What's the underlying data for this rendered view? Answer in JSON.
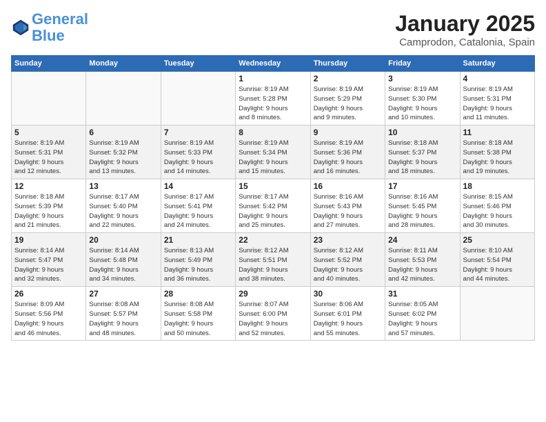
{
  "header": {
    "logo_line1": "General",
    "logo_line2": "Blue",
    "month": "January 2025",
    "location": "Camprodon, Catalonia, Spain"
  },
  "weekdays": [
    "Sunday",
    "Monday",
    "Tuesday",
    "Wednesday",
    "Thursday",
    "Friday",
    "Saturday"
  ],
  "rows": [
    {
      "shaded": false,
      "cells": [
        {
          "empty": true
        },
        {
          "empty": true
        },
        {
          "empty": true
        },
        {
          "day": "1",
          "info": "Sunrise: 8:19 AM\nSunset: 5:28 PM\nDaylight: 9 hours\nand 8 minutes."
        },
        {
          "day": "2",
          "info": "Sunrise: 8:19 AM\nSunset: 5:29 PM\nDaylight: 9 hours\nand 9 minutes."
        },
        {
          "day": "3",
          "info": "Sunrise: 8:19 AM\nSunset: 5:30 PM\nDaylight: 9 hours\nand 10 minutes."
        },
        {
          "day": "4",
          "info": "Sunrise: 8:19 AM\nSunset: 5:31 PM\nDaylight: 9 hours\nand 11 minutes."
        }
      ]
    },
    {
      "shaded": true,
      "cells": [
        {
          "day": "5",
          "info": "Sunrise: 8:19 AM\nSunset: 5:31 PM\nDaylight: 9 hours\nand 12 minutes."
        },
        {
          "day": "6",
          "info": "Sunrise: 8:19 AM\nSunset: 5:32 PM\nDaylight: 9 hours\nand 13 minutes."
        },
        {
          "day": "7",
          "info": "Sunrise: 8:19 AM\nSunset: 5:33 PM\nDaylight: 9 hours\nand 14 minutes."
        },
        {
          "day": "8",
          "info": "Sunrise: 8:19 AM\nSunset: 5:34 PM\nDaylight: 9 hours\nand 15 minutes."
        },
        {
          "day": "9",
          "info": "Sunrise: 8:19 AM\nSunset: 5:36 PM\nDaylight: 9 hours\nand 16 minutes."
        },
        {
          "day": "10",
          "info": "Sunrise: 8:18 AM\nSunset: 5:37 PM\nDaylight: 9 hours\nand 18 minutes."
        },
        {
          "day": "11",
          "info": "Sunrise: 8:18 AM\nSunset: 5:38 PM\nDaylight: 9 hours\nand 19 minutes."
        }
      ]
    },
    {
      "shaded": false,
      "cells": [
        {
          "day": "12",
          "info": "Sunrise: 8:18 AM\nSunset: 5:39 PM\nDaylight: 9 hours\nand 21 minutes."
        },
        {
          "day": "13",
          "info": "Sunrise: 8:17 AM\nSunset: 5:40 PM\nDaylight: 9 hours\nand 22 minutes."
        },
        {
          "day": "14",
          "info": "Sunrise: 8:17 AM\nSunset: 5:41 PM\nDaylight: 9 hours\nand 24 minutes."
        },
        {
          "day": "15",
          "info": "Sunrise: 8:17 AM\nSunset: 5:42 PM\nDaylight: 9 hours\nand 25 minutes."
        },
        {
          "day": "16",
          "info": "Sunrise: 8:16 AM\nSunset: 5:43 PM\nDaylight: 9 hours\nand 27 minutes."
        },
        {
          "day": "17",
          "info": "Sunrise: 8:16 AM\nSunset: 5:45 PM\nDaylight: 9 hours\nand 28 minutes."
        },
        {
          "day": "18",
          "info": "Sunrise: 8:15 AM\nSunset: 5:46 PM\nDaylight: 9 hours\nand 30 minutes."
        }
      ]
    },
    {
      "shaded": true,
      "cells": [
        {
          "day": "19",
          "info": "Sunrise: 8:14 AM\nSunset: 5:47 PM\nDaylight: 9 hours\nand 32 minutes."
        },
        {
          "day": "20",
          "info": "Sunrise: 8:14 AM\nSunset: 5:48 PM\nDaylight: 9 hours\nand 34 minutes."
        },
        {
          "day": "21",
          "info": "Sunrise: 8:13 AM\nSunset: 5:49 PM\nDaylight: 9 hours\nand 36 minutes."
        },
        {
          "day": "22",
          "info": "Sunrise: 8:12 AM\nSunset: 5:51 PM\nDaylight: 9 hours\nand 38 minutes."
        },
        {
          "day": "23",
          "info": "Sunrise: 8:12 AM\nSunset: 5:52 PM\nDaylight: 9 hours\nand 40 minutes."
        },
        {
          "day": "24",
          "info": "Sunrise: 8:11 AM\nSunset: 5:53 PM\nDaylight: 9 hours\nand 42 minutes."
        },
        {
          "day": "25",
          "info": "Sunrise: 8:10 AM\nSunset: 5:54 PM\nDaylight: 9 hours\nand 44 minutes."
        }
      ]
    },
    {
      "shaded": false,
      "cells": [
        {
          "day": "26",
          "info": "Sunrise: 8:09 AM\nSunset: 5:56 PM\nDaylight: 9 hours\nand 46 minutes."
        },
        {
          "day": "27",
          "info": "Sunrise: 8:08 AM\nSunset: 5:57 PM\nDaylight: 9 hours\nand 48 minutes."
        },
        {
          "day": "28",
          "info": "Sunrise: 8:08 AM\nSunset: 5:58 PM\nDaylight: 9 hours\nand 50 minutes."
        },
        {
          "day": "29",
          "info": "Sunrise: 8:07 AM\nSunset: 6:00 PM\nDaylight: 9 hours\nand 52 minutes."
        },
        {
          "day": "30",
          "info": "Sunrise: 8:06 AM\nSunset: 6:01 PM\nDaylight: 9 hours\nand 55 minutes."
        },
        {
          "day": "31",
          "info": "Sunrise: 8:05 AM\nSunset: 6:02 PM\nDaylight: 9 hours\nand 57 minutes."
        },
        {
          "empty": true
        }
      ]
    }
  ]
}
